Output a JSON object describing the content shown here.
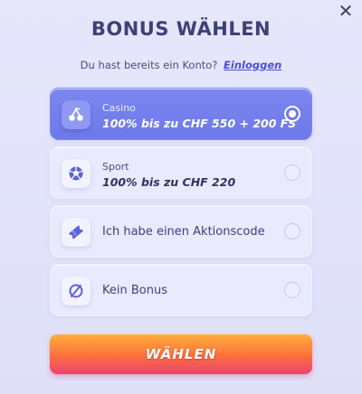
{
  "dialog": {
    "close_label": "✕",
    "title": "BONUS WÄHLEN",
    "login_prompt": "Du hast bereits ein Konto?",
    "login_link": "Einloggen"
  },
  "options": [
    {
      "label": "Casino",
      "detail": "100% bis zu CHF 550 + 200 FS",
      "icon": "cherries-icon",
      "selected": true
    },
    {
      "label": "Sport",
      "detail": "100% bis zu CHF 220",
      "icon": "soccer-ball-icon",
      "selected": false
    },
    {
      "label": "Ich habe einen Aktionscode",
      "icon": "ticket-icon",
      "selected": false
    },
    {
      "label": "Kein Bonus",
      "icon": "no-bonus-icon",
      "selected": false
    }
  ],
  "submit_label": "WÄHLEN",
  "colors": {
    "accent": "#6e79ea",
    "title": "#3d4178",
    "button_top": "#ffae3c",
    "button_bottom": "#f04170"
  }
}
